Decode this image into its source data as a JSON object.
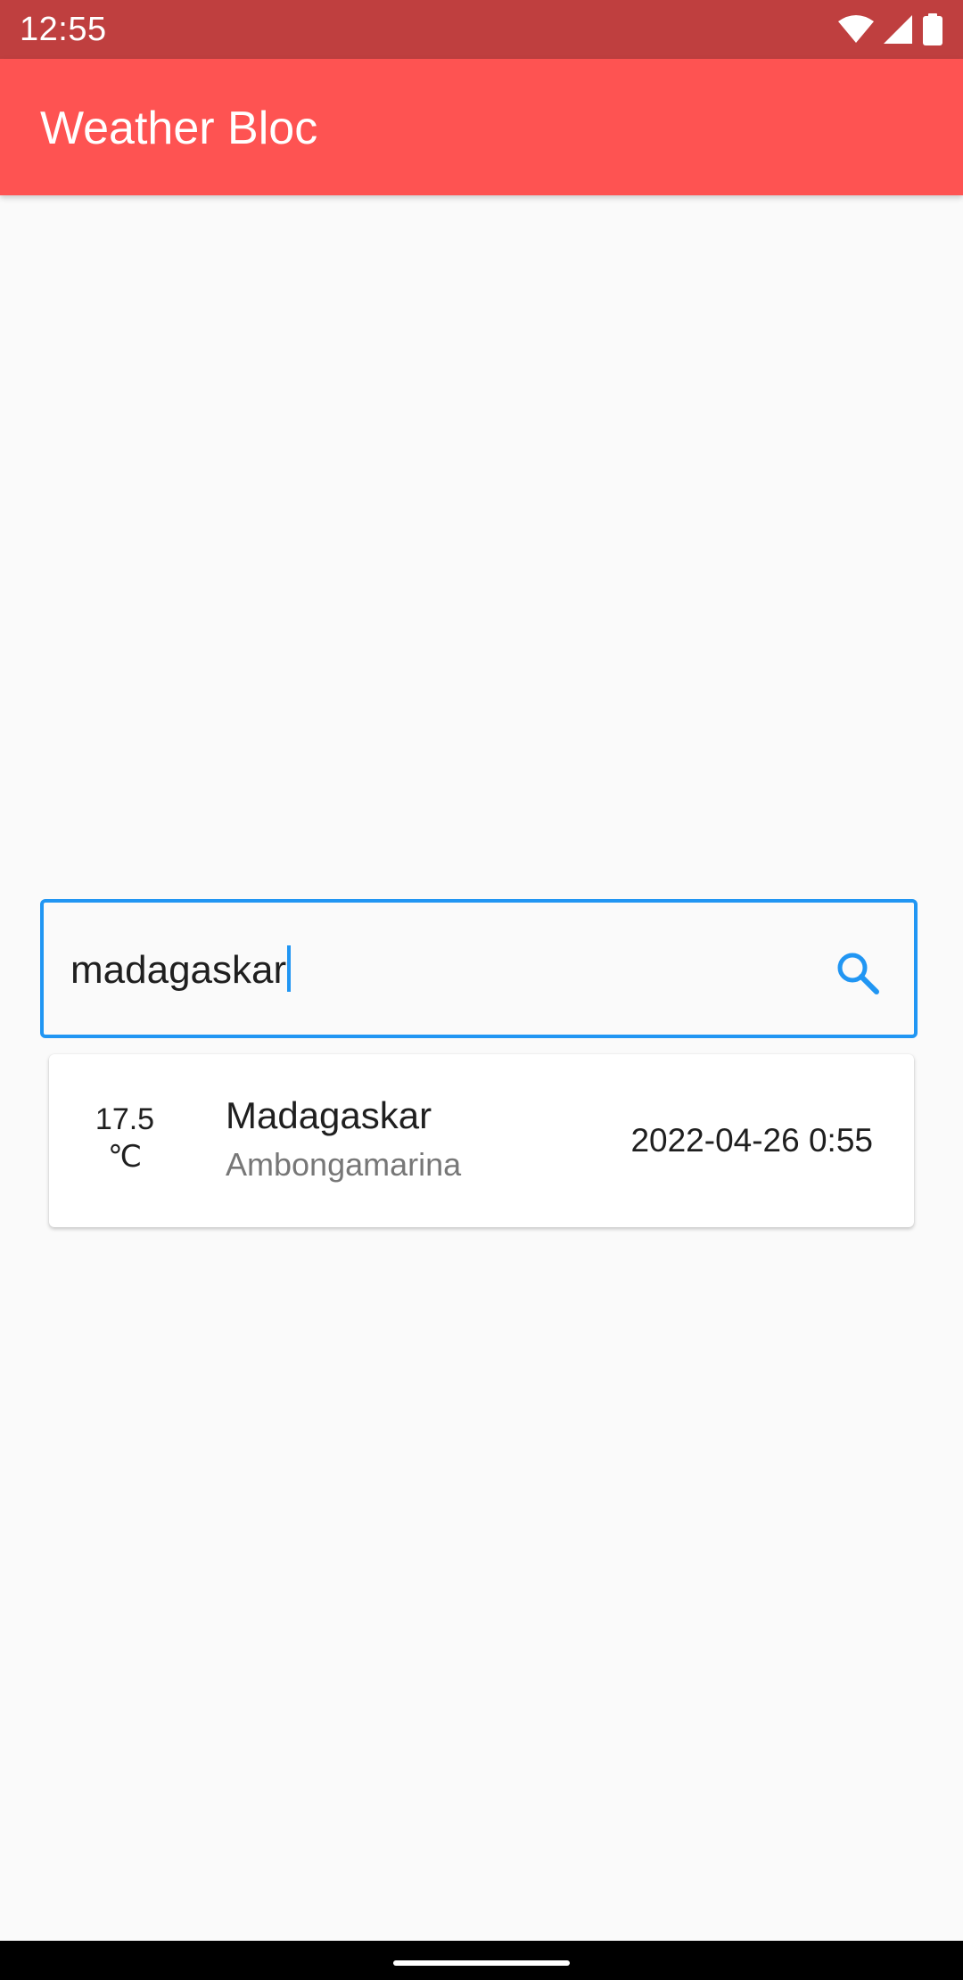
{
  "status_bar": {
    "time": "12:55",
    "icons": [
      "wifi-icon",
      "cell-signal-icon",
      "battery-icon"
    ]
  },
  "app_bar": {
    "title": "Weather Bloc",
    "color": "#fe5352"
  },
  "search": {
    "value": "madagaskar",
    "icon": "search-icon",
    "accent": "#2196f3"
  },
  "results": [
    {
      "temp_value": "17.5",
      "temp_unit": "℃",
      "country": "Madagaskar",
      "region": "Ambongamarina",
      "datetime": "2022-04-26 0:55"
    }
  ]
}
